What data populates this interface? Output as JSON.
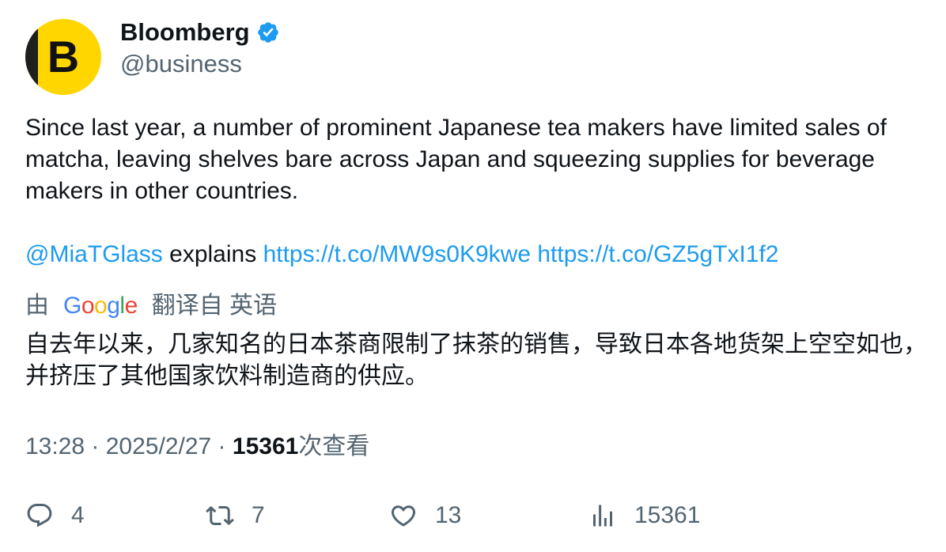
{
  "author": {
    "avatar_letter": "B",
    "name": "Bloomberg",
    "handle": "@business",
    "verified_icon": "verified-badge-icon"
  },
  "tweet": {
    "text": "Since last year, a number of prominent Japanese tea makers have limited sales of matcha, leaving shelves bare across Japan and squeezing supplies for beverage makers in other countries.",
    "mention": "@MiaTGlass",
    "mention_suffix": " explains ",
    "link1": "https://t.co/MW9s0K9kwe",
    "link2": "https://t.co/GZ5gTxI1f2"
  },
  "translation": {
    "prefix": "由",
    "provider": "Google",
    "suffix": "翻译自 英语",
    "text": "自去年以来，几家知名的日本茶商限制了抹茶的销售，导致日本各地货架上空空如也，并挤压了其他国家饮料制造商的供应。"
  },
  "meta": {
    "time": "13:28",
    "sep": " · ",
    "date": "2025/2/27",
    "views_count": "15361",
    "views_label": "次查看"
  },
  "actions": {
    "replies": "4",
    "retweets": "7",
    "likes": "13",
    "views": "15361"
  },
  "colors": {
    "accent": "#1d9bf0",
    "secondary_text": "#536471",
    "brand_yellow": "#ffd600"
  }
}
